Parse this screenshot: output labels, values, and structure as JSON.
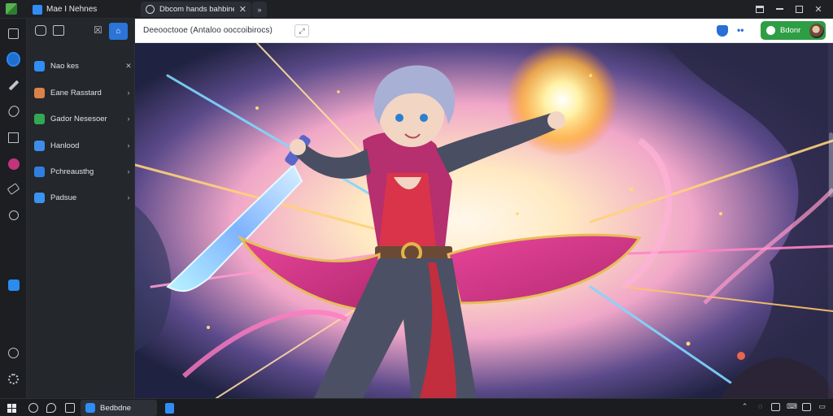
{
  "window": {
    "app_title": "Mae I Nehnes",
    "tab": {
      "label": "Dbcom hands bahbine",
      "close": "✕"
    },
    "tab_more": "»",
    "controls": [
      "panel-icon",
      "minimize-icon",
      "maximize-icon",
      "close-icon"
    ],
    "close_glyph": "✕"
  },
  "rail": {
    "icons": [
      "grid-icon",
      "app-active-icon",
      "pen-icon",
      "clip-icon",
      "square-icon",
      "palette-icon",
      "tag-icon",
      "search-icon",
      "blue-app-icon",
      "circle-icon",
      "settings-icon"
    ]
  },
  "sidebar": {
    "toolbar": {
      "t3": "☒",
      "t4": "⌂"
    },
    "items": [
      {
        "label": "Nao kes",
        "chev": "✕",
        "color": "#2f8df5"
      },
      {
        "label": "Eane Rasstard",
        "chev": "›",
        "color": "#d9824a"
      },
      {
        "label": "Gador Nesesoer",
        "chev": "›",
        "color": "#32a852"
      },
      {
        "label": "Hanlood",
        "chev": "›",
        "color": "#3d8ee8"
      },
      {
        "label": "Pchreausthg",
        "chev": "›",
        "color": "#2f7fe0"
      },
      {
        "label": "Padsue",
        "chev": "›",
        "color": "#3a93f0"
      }
    ]
  },
  "browser": {
    "address": "Deeooctooe (Antaloo ooccoibirocs)",
    "address_btn": "⤢",
    "dots": "••",
    "action_label": "Bdonr",
    "accent": "#2e9e45"
  },
  "taskbar": {
    "app_label": "Bedbdne",
    "tray": [
      "chevron-up-icon",
      "chat-icon",
      "display-icon",
      "keyboard-icon",
      "network-icon",
      "notification-icon"
    ],
    "tray_glyphs": [
      "⌃",
      "◌",
      "",
      "⌨",
      "",
      "▭"
    ]
  }
}
